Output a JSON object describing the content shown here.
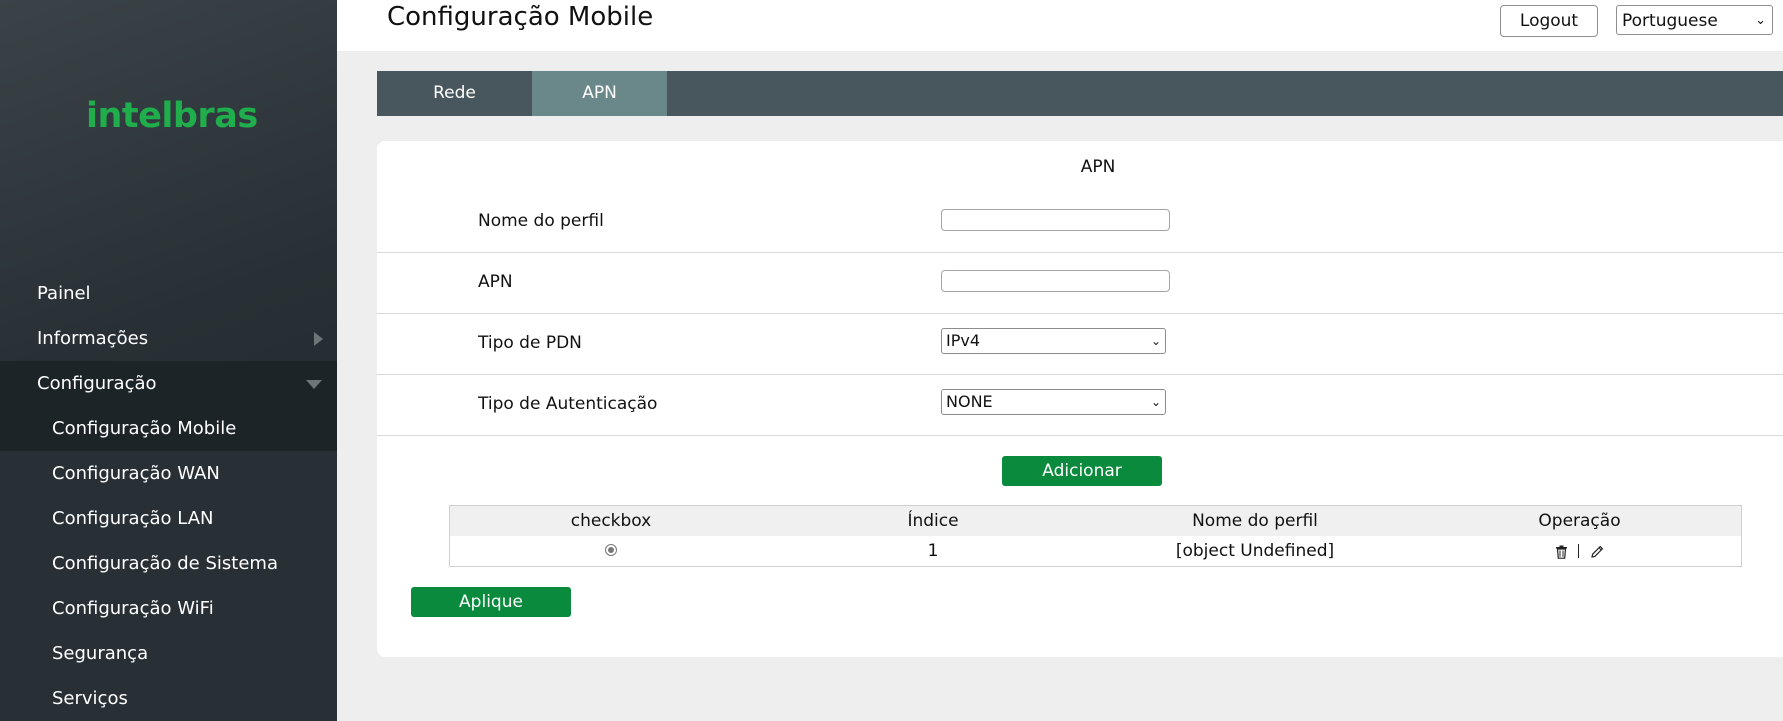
{
  "brand": {
    "logo_text": "intelbras",
    "accent_color": "#1fae4b"
  },
  "sidebar": {
    "items": [
      {
        "label": "Painel",
        "expandable": false
      },
      {
        "label": "Informações",
        "expandable": true,
        "expanded": false
      },
      {
        "label": "Configuração",
        "expandable": true,
        "expanded": true,
        "children": [
          {
            "label": "Configuração Mobile",
            "current": true
          },
          {
            "label": "Configuração WAN"
          },
          {
            "label": "Configuração LAN"
          },
          {
            "label": "Configuração de Sistema"
          },
          {
            "label": "Configuração WiFi"
          },
          {
            "label": "Segurança"
          },
          {
            "label": "Serviços"
          }
        ]
      }
    ]
  },
  "header": {
    "title": "Configuração Mobile",
    "logout_label": "Logout",
    "language": {
      "selected": "Portuguese"
    }
  },
  "tabs": [
    {
      "label": "Rede",
      "active": false
    },
    {
      "label": "APN",
      "active": true
    }
  ],
  "apn_form": {
    "section_title": "APN",
    "fields": [
      {
        "label": "Nome do perfil",
        "type": "text",
        "value": ""
      },
      {
        "label": "APN",
        "type": "text",
        "value": ""
      },
      {
        "label": "Tipo de PDN",
        "type": "select",
        "selected": "IPv4"
      },
      {
        "label": "Tipo de Autenticação",
        "type": "select",
        "selected": "NONE"
      }
    ],
    "add_button": "Adicionar",
    "apply_button": "Aplique"
  },
  "table": {
    "headers": [
      "checkbox",
      "Índice",
      "Nome do perfil",
      "Operação"
    ],
    "rows": [
      {
        "checked": true,
        "index": "1",
        "profile_name": "[object Undefined]",
        "operations": [
          "delete-icon",
          "edit-icon"
        ]
      }
    ]
  },
  "colors": {
    "tab_bar": "#48565d",
    "tab_active": "#6a878a",
    "button_green": "#0a8a3c",
    "sidebar_bg": "#283035"
  }
}
